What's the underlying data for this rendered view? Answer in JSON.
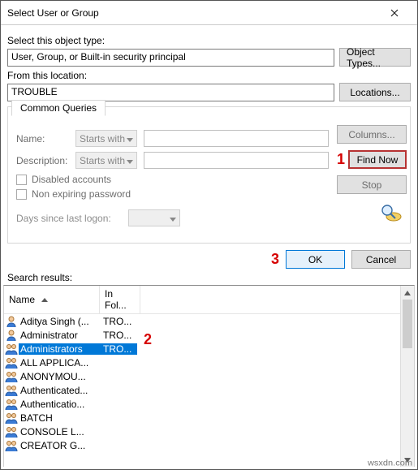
{
  "window": {
    "title": "Select User or Group"
  },
  "objectType": {
    "label": "Select this object type:",
    "value": "User, Group, or Built-in security principal",
    "button": "Object Types..."
  },
  "location": {
    "label": "From this location:",
    "value": "TROUBLE",
    "button": "Locations..."
  },
  "queries": {
    "tab": "Common Queries",
    "name_label": "Name:",
    "name_mode": "Starts with",
    "desc_label": "Description:",
    "desc_mode": "Starts with",
    "disabled_label": "Disabled accounts",
    "nonexpire_label": "Non expiring password",
    "days_label": "Days since last logon:",
    "columns_btn": "Columns...",
    "findnow_btn": "Find Now",
    "stop_btn": "Stop"
  },
  "actions": {
    "ok": "OK",
    "cancel": "Cancel"
  },
  "annotations": {
    "one": "1",
    "two": "2",
    "three": "3"
  },
  "results": {
    "label": "Search results:",
    "col_name": "Name",
    "col_folder": "In Fol...",
    "rows": [
      {
        "name": "Aditya Singh (...",
        "folder": "TRO...",
        "type": "user"
      },
      {
        "name": "Administrator",
        "folder": "TRO...",
        "type": "user"
      },
      {
        "name": "Administrators",
        "folder": "TRO...",
        "type": "group",
        "selected": true
      },
      {
        "name": "ALL APPLICA...",
        "folder": "",
        "type": "group"
      },
      {
        "name": "ANONYMOU...",
        "folder": "",
        "type": "group"
      },
      {
        "name": "Authenticated...",
        "folder": "",
        "type": "group"
      },
      {
        "name": "Authenticatio...",
        "folder": "",
        "type": "group"
      },
      {
        "name": "BATCH",
        "folder": "",
        "type": "group"
      },
      {
        "name": "CONSOLE L...",
        "folder": "",
        "type": "group"
      },
      {
        "name": "CREATOR G...",
        "folder": "",
        "type": "group"
      }
    ]
  },
  "footer": {
    "source": "wsxdn.com"
  }
}
